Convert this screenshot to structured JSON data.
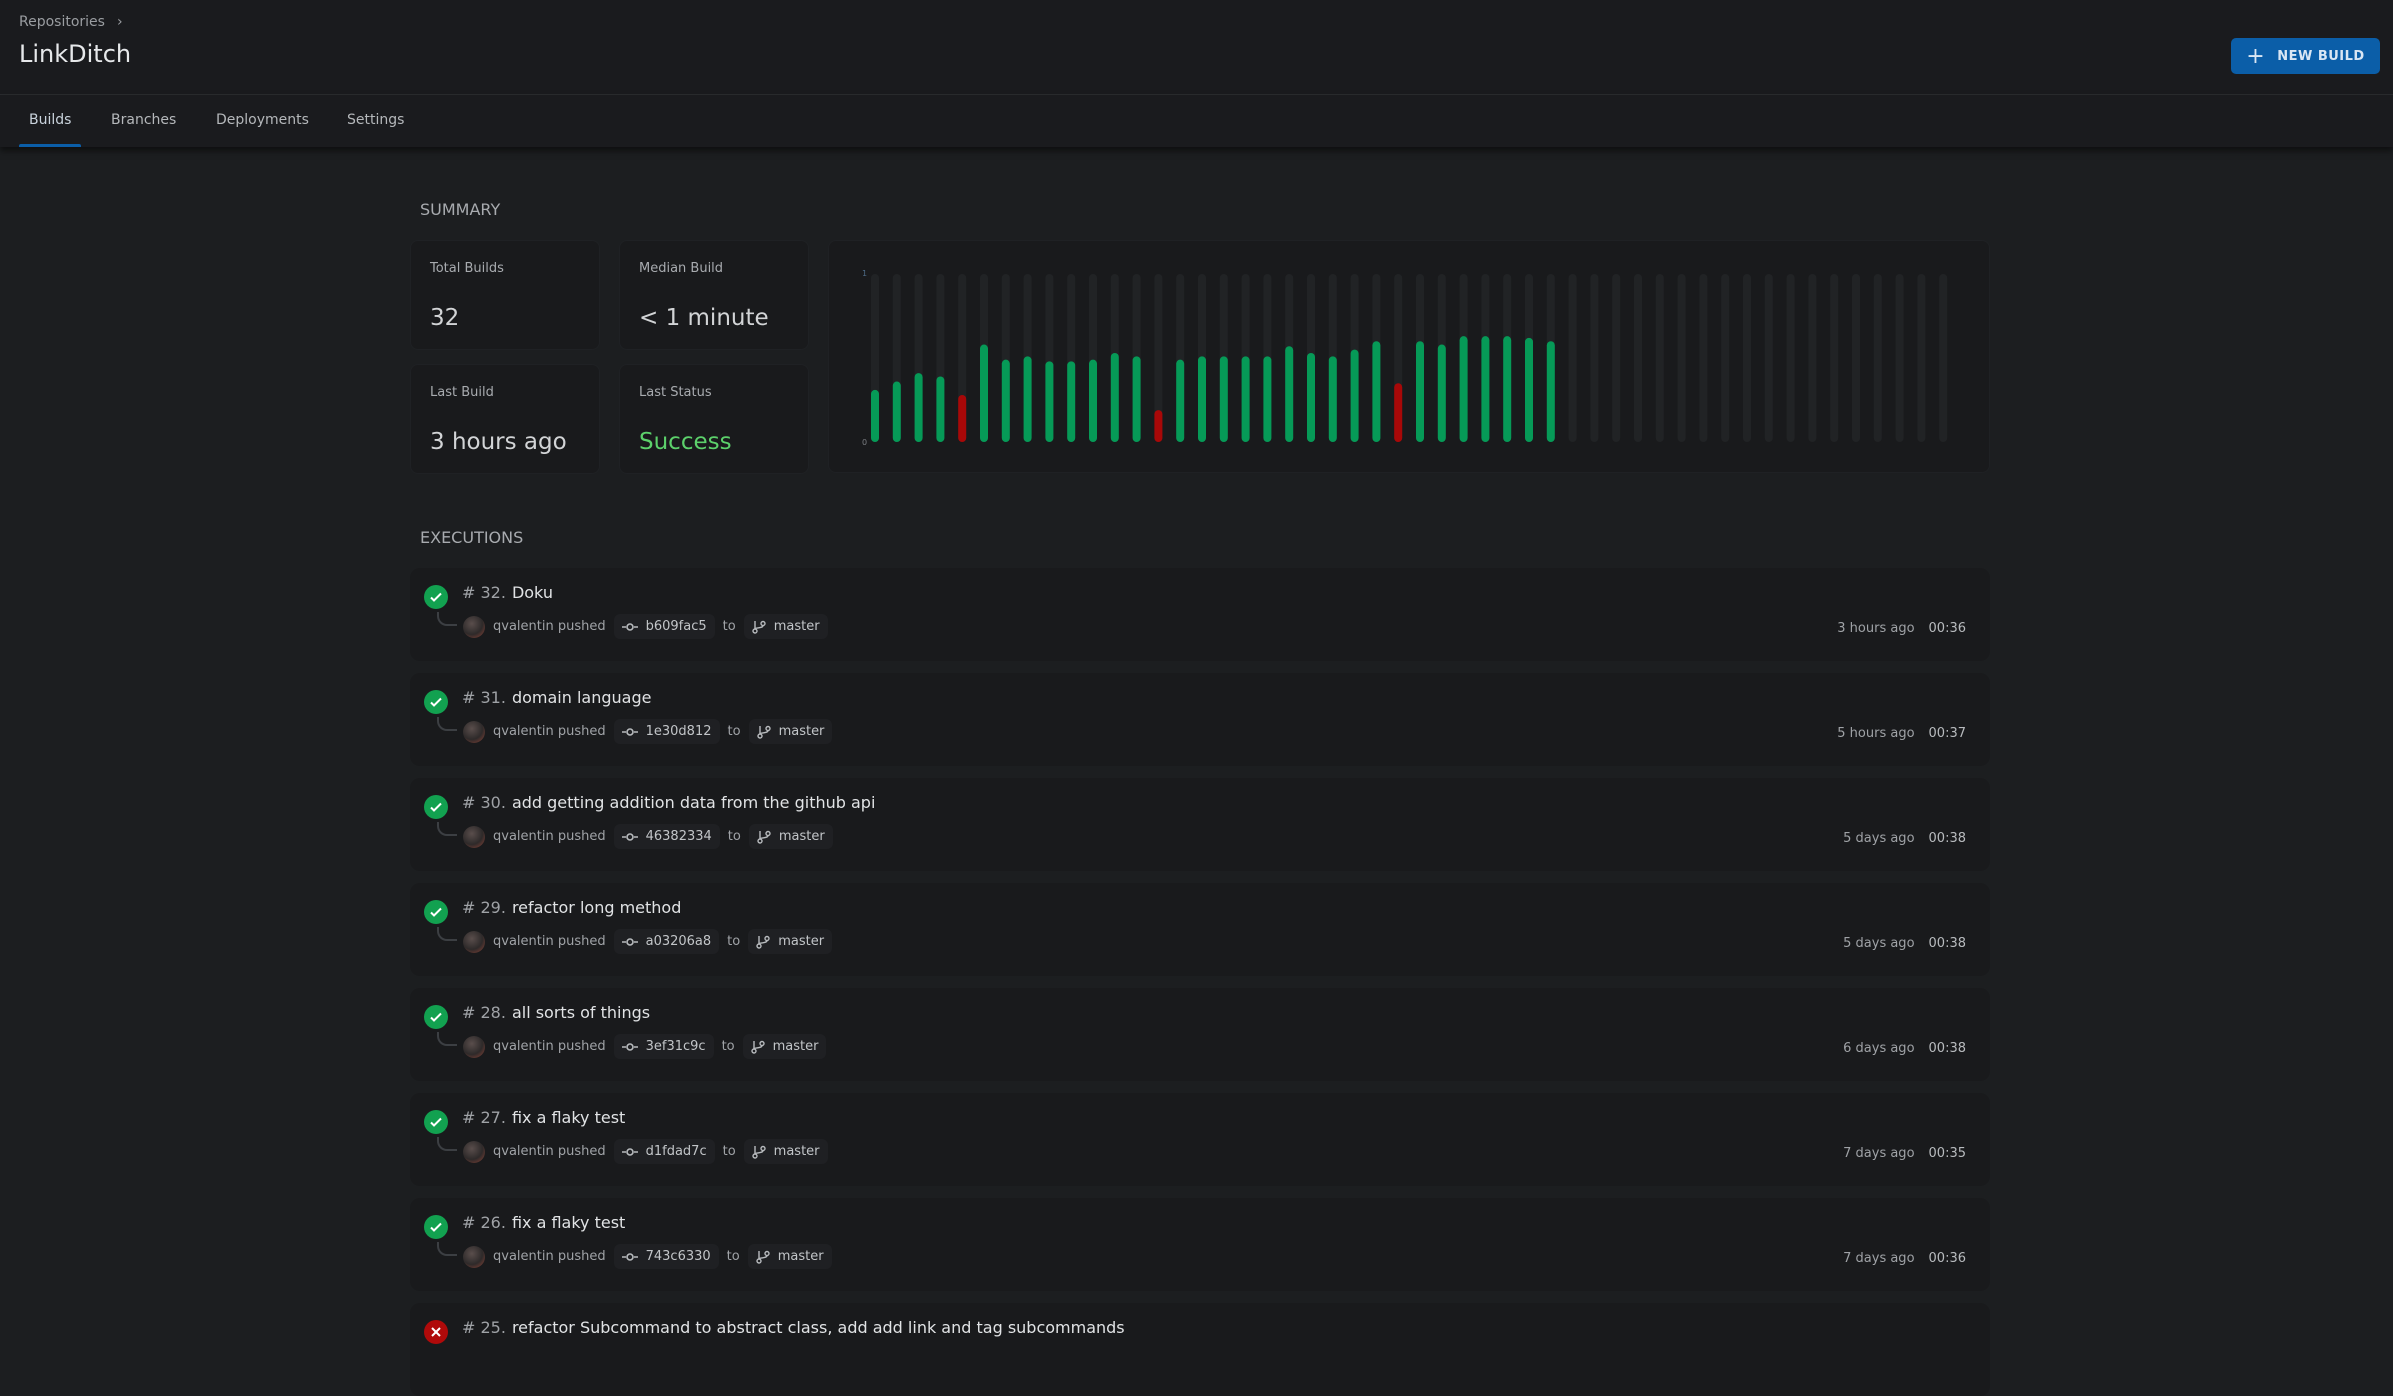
{
  "header": {
    "breadcrumb": "Repositories",
    "title": "LinkDitch",
    "new_build_label": "NEW BUILD"
  },
  "tabs": [
    {
      "label": "Builds",
      "active": true
    },
    {
      "label": "Branches"
    },
    {
      "label": "Deployments"
    },
    {
      "label": "Settings"
    }
  ],
  "summary": {
    "heading": "SUMMARY",
    "total_builds_label": "Total Builds",
    "total_builds": "32",
    "median_label": "Median Build",
    "median": "< 1 minute",
    "last_build_label": "Last Build",
    "last_build": "3 hours ago",
    "last_status_label": "Last Status",
    "last_status": "Success"
  },
  "chart_data": {
    "type": "bar",
    "ylim": [
      0,
      1
    ],
    "yticks": [
      "0",
      "1"
    ],
    "slots": 50,
    "categories": [
      1,
      2,
      3,
      4,
      5,
      6,
      7,
      8,
      9,
      10,
      11,
      12,
      13,
      14,
      15,
      16,
      17,
      18,
      19,
      20,
      21,
      22,
      23,
      24,
      25,
      26,
      27,
      28,
      29,
      30,
      31,
      32
    ],
    "values": [
      0.31,
      0.36,
      0.41,
      0.39,
      0.28,
      0.58,
      0.49,
      0.51,
      0.48,
      0.48,
      0.49,
      0.53,
      0.51,
      0.19,
      0.49,
      0.51,
      0.51,
      0.51,
      0.51,
      0.57,
      0.53,
      0.51,
      0.55,
      0.6,
      0.35,
      0.6,
      0.58,
      0.63,
      0.63,
      0.63,
      0.62,
      0.6
    ],
    "status": [
      "success",
      "success",
      "success",
      "success",
      "failure",
      "success",
      "success",
      "success",
      "success",
      "success",
      "success",
      "success",
      "success",
      "failure",
      "success",
      "success",
      "success",
      "success",
      "success",
      "success",
      "success",
      "success",
      "success",
      "success",
      "failure",
      "success",
      "success",
      "success",
      "success",
      "success",
      "success",
      "success"
    ],
    "colors": {
      "success": "#069a57",
      "failure": "#a80808",
      "empty": "#212325"
    }
  },
  "executions": {
    "heading": "EXECUTIONS",
    "items": [
      {
        "num": "# 32.",
        "title": "Doku",
        "status": "success",
        "user": "qvalentin pushed",
        "commit": "b609fac5",
        "to": "to",
        "branch": "master",
        "time": "3 hours ago",
        "duration": "00:36"
      },
      {
        "num": "# 31.",
        "title": "domain language",
        "status": "success",
        "user": "qvalentin pushed",
        "commit": "1e30d812",
        "to": "to",
        "branch": "master",
        "time": "5 hours ago",
        "duration": "00:37"
      },
      {
        "num": "# 30.",
        "title": "add getting addition data from the github api",
        "status": "success",
        "user": "qvalentin pushed",
        "commit": "46382334",
        "to": "to",
        "branch": "master",
        "time": "5 days ago",
        "duration": "00:38"
      },
      {
        "num": "# 29.",
        "title": "refactor long method",
        "status": "success",
        "user": "qvalentin pushed",
        "commit": "a03206a8",
        "to": "to",
        "branch": "master",
        "time": "5 days ago",
        "duration": "00:38"
      },
      {
        "num": "# 28.",
        "title": "all sorts of things",
        "status": "success",
        "user": "qvalentin pushed",
        "commit": "3ef31c9c",
        "to": "to",
        "branch": "master",
        "time": "6 days ago",
        "duration": "00:38"
      },
      {
        "num": "# 27.",
        "title": "fix a flaky test",
        "status": "success",
        "user": "qvalentin pushed",
        "commit": "d1fdad7c",
        "to": "to",
        "branch": "master",
        "time": "7 days ago",
        "duration": "00:35"
      },
      {
        "num": "# 26.",
        "title": "fix a flaky test",
        "status": "success",
        "user": "qvalentin pushed",
        "commit": "743c6330",
        "to": "to",
        "branch": "master",
        "time": "7 days ago",
        "duration": "00:36"
      },
      {
        "num": "# 25.",
        "title": "refactor Subcommand to abstract class, add add link and tag subcommands",
        "status": "failure"
      }
    ]
  }
}
